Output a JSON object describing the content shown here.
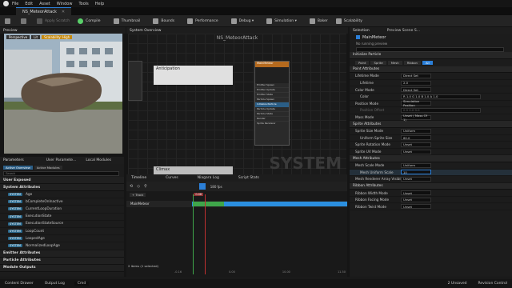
{
  "menu": [
    "File",
    "Edit",
    "Asset",
    "Window",
    "Tools",
    "Help"
  ],
  "doc_tab": "NS_MeteorAttack",
  "toolbar": {
    "items": [
      {
        "label": "Apply Scratch",
        "color": "#666"
      },
      {
        "label": "Compile",
        "color": "#5ad06a"
      },
      {
        "label": "Thumbnail",
        "color": "#aaa"
      },
      {
        "label": "Bounds",
        "color": "#aaa"
      },
      {
        "label": "Performance",
        "color": "#aaa"
      },
      {
        "label": "Debug ▾",
        "color": "#aaa"
      },
      {
        "label": "Simulation ▾",
        "color": "#aaa"
      },
      {
        "label": "Baker",
        "color": "#aaa"
      },
      {
        "label": "Scalability",
        "color": "#aaa"
      }
    ]
  },
  "preview": {
    "title": "Preview",
    "mode": "Perspective",
    "lit": "Lit",
    "scalability": "Scalability: High"
  },
  "system_overview": {
    "tab": "System Overview",
    "title": "NS_MeteorAttack",
    "watermark": "SYSTEM",
    "emitter_name": "MainMeteor",
    "comment": "Anticipation",
    "comment2": "Climax"
  },
  "node_rows": [
    "Emitter Spawn",
    "Emitter Update",
    "Emitter State",
    "Particle Spawn",
    "Initialize Particle",
    "Particle Update",
    "Particle State",
    "Render",
    "Sprite Renderer"
  ],
  "params": {
    "tabs": [
      "Parameters",
      "User Paramete...",
      "Local Modules"
    ],
    "subtabs": [
      "Active Overview",
      "Active Modules"
    ],
    "search_placeholder": "Search",
    "user_exposed": "User Exposed",
    "system_attributes": "System Attributes",
    "rows": [
      {
        "badge": "SYSTEM",
        "name": "Age"
      },
      {
        "badge": "SYSTEM",
        "name": "bCompleteOnInactive"
      },
      {
        "badge": "SYSTEM",
        "name": "CurrentLoopDuration"
      },
      {
        "badge": "SYSTEM",
        "name": "ExecutionState"
      },
      {
        "badge": "SYSTEM",
        "name": "ExecutionStateSource"
      },
      {
        "badge": "SYSTEM",
        "name": "LoopCount"
      },
      {
        "badge": "SYSTEM",
        "name": "LoopedAge"
      },
      {
        "badge": "SYSTEM",
        "name": "NormalizedLoopAge"
      }
    ],
    "emitter_attributes": "Emitter Attributes",
    "particle_attributes": "Particle Attributes",
    "module_outputs": "Module Outputs"
  },
  "timeline": {
    "tabs": [
      "Timeline",
      "Curves",
      "Niagara Log",
      "Script Stats"
    ],
    "fps": "180 fps",
    "time": "0.06",
    "track_button": "+ Track",
    "track_name": "MainMeteor",
    "bar_label": "MainMeteor",
    "selection": "2 items (1 selected)",
    "ticks": [
      "-0.16",
      "0.00",
      "10.00",
      "11.50"
    ]
  },
  "details": {
    "tabs": [
      "Selection",
      "Preview Scene S..."
    ],
    "emitter": "MainMeteor",
    "status": "No running preview",
    "section_init": "Initialize Particle",
    "render_tabs": [
      "Point",
      "Sprite",
      "Mesh",
      "Ribbon",
      "All"
    ],
    "groups": [
      {
        "title": "Point Attributes",
        "rows": [
          {
            "label": "Lifetime Mode",
            "value": "Direct Set"
          },
          {
            "label": "Lifetime",
            "value": "2.0"
          },
          {
            "label": "Color Mode",
            "value": "Direct Set"
          },
          {
            "label": "Color",
            "value": "R 1.0  G 1.0  B 1.0  A 1.0"
          },
          {
            "label": "Position Mode",
            "value": "Simulation Position"
          },
          {
            "label": "Position Offset",
            "value": "0.0  0.0  0.0"
          },
          {
            "label": "Mass Mode",
            "value": "Unset ( Mass Of 1)"
          }
        ]
      },
      {
        "title": "Sprite Attributes",
        "rows": [
          {
            "label": "Sprite Size Mode",
            "value": "Uniform"
          },
          {
            "label": "Uniform Sprite Size",
            "value": "60.0"
          },
          {
            "label": "Sprite Rotation Mode",
            "value": "Unset"
          },
          {
            "label": "Sprite UV Mode",
            "value": "Unset"
          }
        ]
      },
      {
        "title": "Mesh Attributes",
        "rows": [
          {
            "label": "Mesh Scale Mode",
            "value": "Uniform"
          },
          {
            "label": "Mesh Uniform Scale",
            "value": "10"
          },
          {
            "label": "Mesh Renderer Array Visibility",
            "value": "Unset"
          }
        ]
      },
      {
        "title": "Ribbon Attributes",
        "rows": [
          {
            "label": "Ribbon Width Mode",
            "value": "Unset"
          },
          {
            "label": "Ribbon Facing Mode",
            "value": "Unset"
          },
          {
            "label": "Ribbon Twist Mode",
            "value": "Unset"
          }
        ]
      }
    ]
  },
  "status": {
    "drawer": "Content Drawer",
    "output": "Output Log",
    "cmd": "Cmd",
    "source": "2 Unsaved",
    "revision": "Revision Control"
  }
}
